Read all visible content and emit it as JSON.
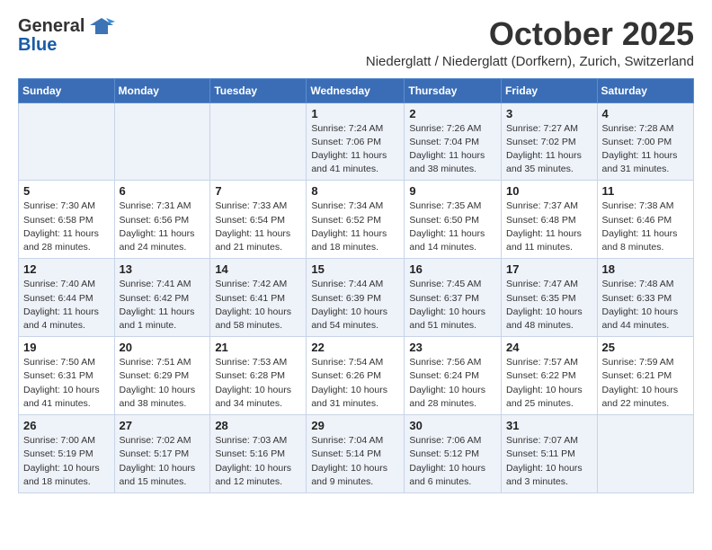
{
  "logo": {
    "general": "General",
    "blue": "Blue",
    "tagline": ""
  },
  "title": "October 2025",
  "subtitle": "Niederglatt / Niederglatt (Dorfkern), Zurich, Switzerland",
  "days_of_week": [
    "Sunday",
    "Monday",
    "Tuesday",
    "Wednesday",
    "Thursday",
    "Friday",
    "Saturday"
  ],
  "weeks": [
    [
      {
        "day": "",
        "info": ""
      },
      {
        "day": "",
        "info": ""
      },
      {
        "day": "",
        "info": ""
      },
      {
        "day": "1",
        "info": "Sunrise: 7:24 AM\nSunset: 7:06 PM\nDaylight: 11 hours and 41 minutes."
      },
      {
        "day": "2",
        "info": "Sunrise: 7:26 AM\nSunset: 7:04 PM\nDaylight: 11 hours and 38 minutes."
      },
      {
        "day": "3",
        "info": "Sunrise: 7:27 AM\nSunset: 7:02 PM\nDaylight: 11 hours and 35 minutes."
      },
      {
        "day": "4",
        "info": "Sunrise: 7:28 AM\nSunset: 7:00 PM\nDaylight: 11 hours and 31 minutes."
      }
    ],
    [
      {
        "day": "5",
        "info": "Sunrise: 7:30 AM\nSunset: 6:58 PM\nDaylight: 11 hours and 28 minutes."
      },
      {
        "day": "6",
        "info": "Sunrise: 7:31 AM\nSunset: 6:56 PM\nDaylight: 11 hours and 24 minutes."
      },
      {
        "day": "7",
        "info": "Sunrise: 7:33 AM\nSunset: 6:54 PM\nDaylight: 11 hours and 21 minutes."
      },
      {
        "day": "8",
        "info": "Sunrise: 7:34 AM\nSunset: 6:52 PM\nDaylight: 11 hours and 18 minutes."
      },
      {
        "day": "9",
        "info": "Sunrise: 7:35 AM\nSunset: 6:50 PM\nDaylight: 11 hours and 14 minutes."
      },
      {
        "day": "10",
        "info": "Sunrise: 7:37 AM\nSunset: 6:48 PM\nDaylight: 11 hours and 11 minutes."
      },
      {
        "day": "11",
        "info": "Sunrise: 7:38 AM\nSunset: 6:46 PM\nDaylight: 11 hours and 8 minutes."
      }
    ],
    [
      {
        "day": "12",
        "info": "Sunrise: 7:40 AM\nSunset: 6:44 PM\nDaylight: 11 hours and 4 minutes."
      },
      {
        "day": "13",
        "info": "Sunrise: 7:41 AM\nSunset: 6:42 PM\nDaylight: 11 hours and 1 minute."
      },
      {
        "day": "14",
        "info": "Sunrise: 7:42 AM\nSunset: 6:41 PM\nDaylight: 10 hours and 58 minutes."
      },
      {
        "day": "15",
        "info": "Sunrise: 7:44 AM\nSunset: 6:39 PM\nDaylight: 10 hours and 54 minutes."
      },
      {
        "day": "16",
        "info": "Sunrise: 7:45 AM\nSunset: 6:37 PM\nDaylight: 10 hours and 51 minutes."
      },
      {
        "day": "17",
        "info": "Sunrise: 7:47 AM\nSunset: 6:35 PM\nDaylight: 10 hours and 48 minutes."
      },
      {
        "day": "18",
        "info": "Sunrise: 7:48 AM\nSunset: 6:33 PM\nDaylight: 10 hours and 44 minutes."
      }
    ],
    [
      {
        "day": "19",
        "info": "Sunrise: 7:50 AM\nSunset: 6:31 PM\nDaylight: 10 hours and 41 minutes."
      },
      {
        "day": "20",
        "info": "Sunrise: 7:51 AM\nSunset: 6:29 PM\nDaylight: 10 hours and 38 minutes."
      },
      {
        "day": "21",
        "info": "Sunrise: 7:53 AM\nSunset: 6:28 PM\nDaylight: 10 hours and 34 minutes."
      },
      {
        "day": "22",
        "info": "Sunrise: 7:54 AM\nSunset: 6:26 PM\nDaylight: 10 hours and 31 minutes."
      },
      {
        "day": "23",
        "info": "Sunrise: 7:56 AM\nSunset: 6:24 PM\nDaylight: 10 hours and 28 minutes."
      },
      {
        "day": "24",
        "info": "Sunrise: 7:57 AM\nSunset: 6:22 PM\nDaylight: 10 hours and 25 minutes."
      },
      {
        "day": "25",
        "info": "Sunrise: 7:59 AM\nSunset: 6:21 PM\nDaylight: 10 hours and 22 minutes."
      }
    ],
    [
      {
        "day": "26",
        "info": "Sunrise: 7:00 AM\nSunset: 5:19 PM\nDaylight: 10 hours and 18 minutes."
      },
      {
        "day": "27",
        "info": "Sunrise: 7:02 AM\nSunset: 5:17 PM\nDaylight: 10 hours and 15 minutes."
      },
      {
        "day": "28",
        "info": "Sunrise: 7:03 AM\nSunset: 5:16 PM\nDaylight: 10 hours and 12 minutes."
      },
      {
        "day": "29",
        "info": "Sunrise: 7:04 AM\nSunset: 5:14 PM\nDaylight: 10 hours and 9 minutes."
      },
      {
        "day": "30",
        "info": "Sunrise: 7:06 AM\nSunset: 5:12 PM\nDaylight: 10 hours and 6 minutes."
      },
      {
        "day": "31",
        "info": "Sunrise: 7:07 AM\nSunset: 5:11 PM\nDaylight: 10 hours and 3 minutes."
      },
      {
        "day": "",
        "info": ""
      }
    ]
  ],
  "accent_color": "#3a6db5"
}
